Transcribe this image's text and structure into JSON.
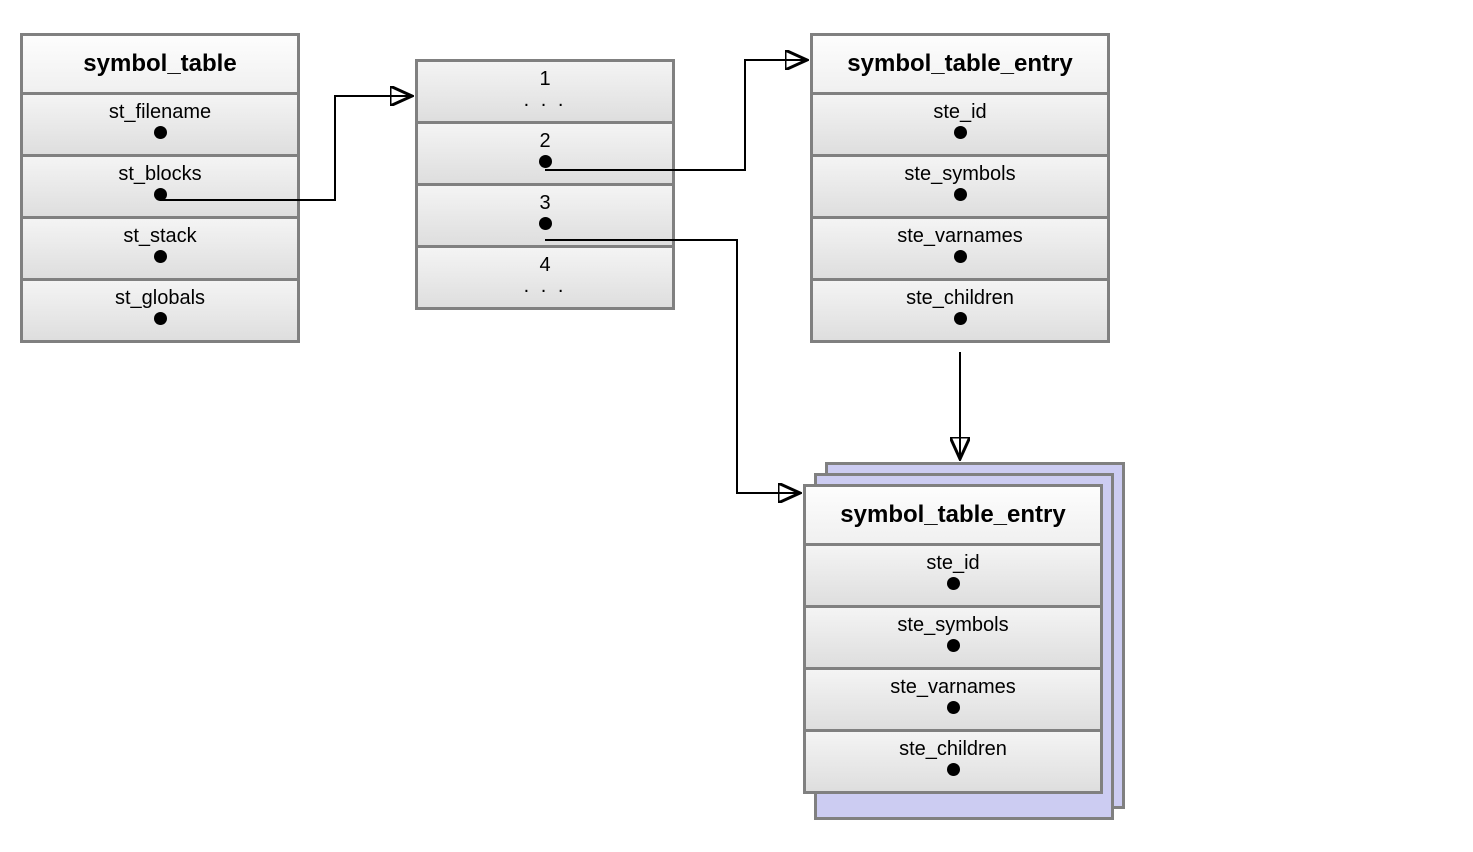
{
  "symbol_table": {
    "title": "symbol_table",
    "rows": [
      "st_filename",
      "st_blocks",
      "st_stack",
      "st_globals"
    ]
  },
  "array_box": {
    "rows": [
      {
        "n": "1",
        "ellipsis": ". . ."
      },
      {
        "n": "2",
        "dot": true
      },
      {
        "n": "3",
        "dot": true
      },
      {
        "n": "4",
        "ellipsis": ". . ."
      }
    ]
  },
  "entry_top": {
    "title": "symbol_table_entry",
    "rows": [
      "ste_id",
      "ste_symbols",
      "ste_varnames",
      "ste_children"
    ]
  },
  "entry_bottom": {
    "title": "symbol_table_entry",
    "rows": [
      "ste_id",
      "ste_symbols",
      "ste_varnames",
      "ste_children"
    ]
  }
}
